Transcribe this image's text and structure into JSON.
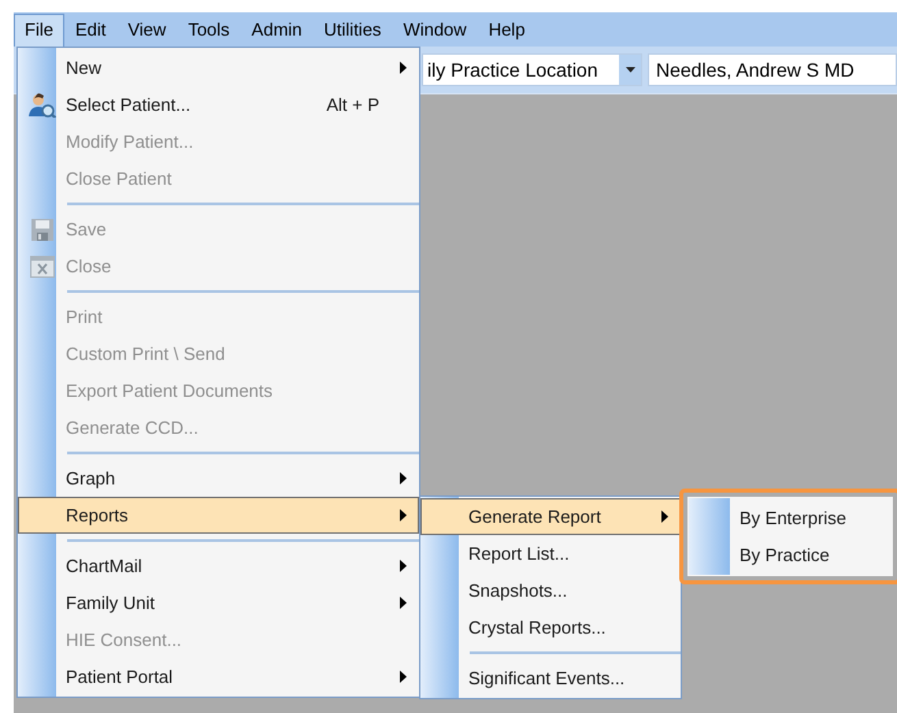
{
  "menu_bar": [
    {
      "label": "File",
      "selected": true
    },
    {
      "label": "Edit",
      "selected": false
    },
    {
      "label": "View",
      "selected": false
    },
    {
      "label": "Tools",
      "selected": false
    },
    {
      "label": "Admin",
      "selected": false
    },
    {
      "label": "Utilities",
      "selected": false
    },
    {
      "label": "Window",
      "selected": false
    },
    {
      "label": "Help",
      "selected": false
    }
  ],
  "toolbar": {
    "location_combo": {
      "value": "ily Practice Location"
    },
    "provider_field": {
      "value": "Needles, Andrew S MD"
    }
  },
  "file_menu": [
    {
      "kind": "item",
      "label": "New",
      "disabled": false,
      "submenu": true,
      "selected": false
    },
    {
      "kind": "patient",
      "label": "Select Patient...",
      "shortcut": "Alt + P",
      "disabled": false,
      "submenu": false,
      "selected": false
    },
    {
      "kind": "item",
      "label": "Modify Patient...",
      "disabled": true,
      "submenu": false,
      "selected": false
    },
    {
      "kind": "item",
      "label": "Close Patient",
      "disabled": true,
      "submenu": false,
      "selected": false
    },
    {
      "kind": "separator"
    },
    {
      "kind": "save",
      "label": "Save",
      "disabled": true,
      "submenu": false,
      "selected": false
    },
    {
      "kind": "close",
      "label": "Close",
      "disabled": true,
      "submenu": false,
      "selected": false
    },
    {
      "kind": "separator"
    },
    {
      "kind": "item",
      "label": "Print",
      "disabled": true,
      "submenu": false,
      "selected": false
    },
    {
      "kind": "item",
      "label": "Custom Print \\ Send",
      "disabled": true,
      "submenu": false,
      "selected": false
    },
    {
      "kind": "item",
      "label": "Export Patient Documents",
      "disabled": true,
      "submenu": false,
      "selected": false
    },
    {
      "kind": "item",
      "label": "Generate CCD...",
      "disabled": true,
      "submenu": false,
      "selected": false
    },
    {
      "kind": "separator"
    },
    {
      "kind": "item",
      "label": "Graph",
      "disabled": false,
      "submenu": true,
      "selected": false
    },
    {
      "kind": "item",
      "label": "Reports",
      "disabled": false,
      "submenu": true,
      "selected": true
    },
    {
      "kind": "separator"
    },
    {
      "kind": "item",
      "label": "ChartMail",
      "disabled": false,
      "submenu": true,
      "selected": false
    },
    {
      "kind": "item",
      "label": "Family Unit",
      "disabled": false,
      "submenu": true,
      "selected": false
    },
    {
      "kind": "item",
      "label": "HIE Consent...",
      "disabled": true,
      "submenu": false,
      "selected": false
    },
    {
      "kind": "item",
      "label": "Patient Portal",
      "disabled": false,
      "submenu": true,
      "selected": false
    }
  ],
  "reports_menu": [
    {
      "kind": "item",
      "label": "Generate Report",
      "disabled": false,
      "submenu": true,
      "selected": true
    },
    {
      "kind": "item",
      "label": "Report List...",
      "disabled": false,
      "submenu": false,
      "selected": false
    },
    {
      "kind": "item",
      "label": "Snapshots...",
      "disabled": false,
      "submenu": false,
      "selected": false
    },
    {
      "kind": "item",
      "label": "Crystal Reports...",
      "disabled": false,
      "submenu": false,
      "selected": false
    },
    {
      "kind": "separator"
    },
    {
      "kind": "item",
      "label": "Significant Events...",
      "disabled": false,
      "submenu": false,
      "selected": false
    }
  ],
  "generate_report_menu": {
    "highlighted": true,
    "items": [
      {
        "kind": "item",
        "label": "By Enterprise",
        "disabled": false,
        "submenu": false,
        "selected": false
      },
      {
        "kind": "item",
        "label": "By Practice",
        "disabled": false,
        "submenu": false,
        "selected": false
      }
    ]
  }
}
